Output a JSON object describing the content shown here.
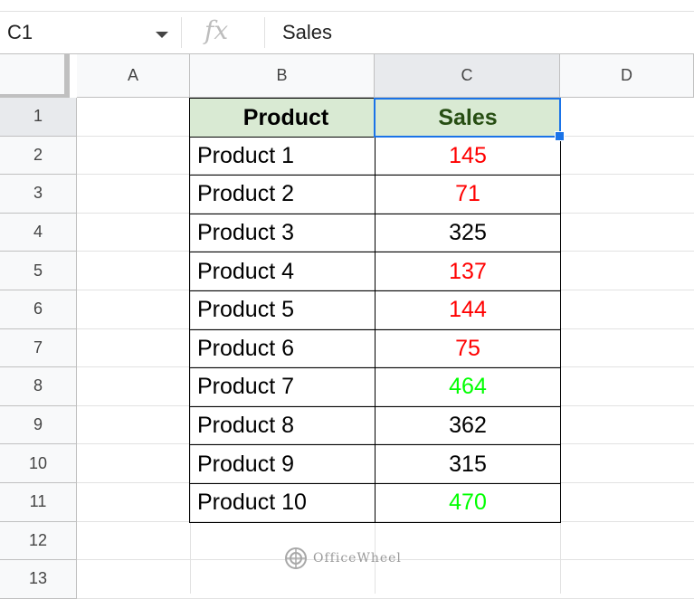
{
  "formula_bar": {
    "name_box": "C1",
    "fx_label": "fx",
    "content": "Sales"
  },
  "columns": [
    "A",
    "B",
    "C",
    "D"
  ],
  "rows": [
    "1",
    "2",
    "3",
    "4",
    "5",
    "6",
    "7",
    "8",
    "9",
    "10",
    "11",
    "12",
    "13"
  ],
  "selected_cell": "C1",
  "table": {
    "headers": {
      "product": "Product",
      "sales": "Sales"
    },
    "rows": [
      {
        "product": "Product 1",
        "sales": "145",
        "color": "#ff0000"
      },
      {
        "product": "Product 2",
        "sales": "71",
        "color": "#ff0000"
      },
      {
        "product": "Product 3",
        "sales": "325",
        "color": "#000000"
      },
      {
        "product": "Product 4",
        "sales": "137",
        "color": "#ff0000"
      },
      {
        "product": "Product 5",
        "sales": "144",
        "color": "#ff0000"
      },
      {
        "product": "Product 6",
        "sales": "75",
        "color": "#ff0000"
      },
      {
        "product": "Product 7",
        "sales": "464",
        "color": "#00ff00"
      },
      {
        "product": "Product 8",
        "sales": "362",
        "color": "#000000"
      },
      {
        "product": "Product 9",
        "sales": "315",
        "color": "#000000"
      },
      {
        "product": "Product 10",
        "sales": "470",
        "color": "#00ff00"
      }
    ]
  },
  "colors": {
    "header_fill": "#d9ead3",
    "header_text": "#274e13",
    "selection": "#1a73e8"
  },
  "watermark": "OfficeWheel"
}
